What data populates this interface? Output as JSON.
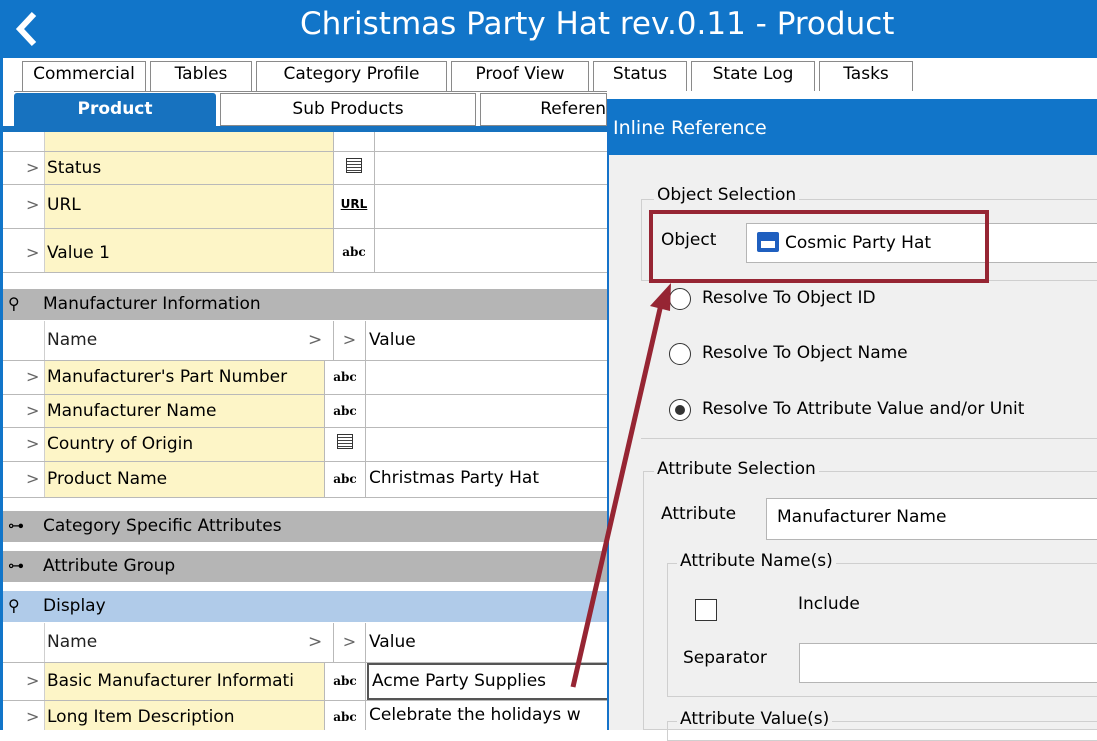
{
  "window": {
    "title": "Christmas Party Hat rev.0.11 - Product",
    "back_icon": "chevron-left-icon"
  },
  "tabs_row1": [
    {
      "label": "Commercial"
    },
    {
      "label": "Tables"
    },
    {
      "label": "Category Profile"
    },
    {
      "label": "Proof View"
    },
    {
      "label": "Status"
    },
    {
      "label": "State Log"
    },
    {
      "label": "Tasks"
    }
  ],
  "tabs_row2": [
    {
      "label": "Product",
      "active": true
    },
    {
      "label": "Sub Products"
    },
    {
      "label": "Referen"
    }
  ],
  "grid": {
    "top_rows": [
      {
        "name": "Status",
        "type_icon": "list-icon"
      },
      {
        "name": "URL",
        "type_icon": "url-icon",
        "type_text": "URL"
      },
      {
        "name": "Value 1",
        "type_icon": "text-icon",
        "type_text": "abc"
      }
    ],
    "manufacturer_group": "Manufacturer Information",
    "header": {
      "name": "Name",
      "value": "Value"
    },
    "manufacturer_rows": [
      {
        "name": "Manufacturer's Part Number",
        "type_text": "abc",
        "value": ""
      },
      {
        "name": "Manufacturer Name",
        "type_text": "abc",
        "value": ""
      },
      {
        "name": "Country of Origin",
        "type_icon": "list-icon",
        "value": ""
      },
      {
        "name": "Product Name",
        "type_text": "abc",
        "value": "Christmas Party Hat"
      }
    ],
    "category_group": "Category Specific Attributes",
    "attribute_group": "Attribute Group",
    "display_group": "Display",
    "display_rows": [
      {
        "name": "Basic Manufacturer Informati",
        "type_text": "abc",
        "value": "Acme Party Supplies"
      },
      {
        "name": "Long Item Description",
        "type_text": "abc",
        "value": "Celebrate the holidays w"
      }
    ],
    "expander": ">"
  },
  "dialog": {
    "title": "Inline Reference",
    "object_selection": {
      "legend": "Object Selection",
      "object_label": "Object",
      "object_value": "Cosmic Party Hat",
      "options": [
        {
          "label": "Resolve To Object ID",
          "checked": false
        },
        {
          "label": "Resolve To Object Name",
          "checked": false
        },
        {
          "label": "Resolve To Attribute Value and/or Unit",
          "checked": true
        }
      ]
    },
    "attribute_selection": {
      "legend": "Attribute Selection",
      "attribute_label": "Attribute",
      "attribute_value": "Manufacturer Name",
      "names_legend": "Attribute Name(s)",
      "include_label": "Include",
      "separator_label": "Separator",
      "separator_value": "",
      "values_legend": "Attribute Value(s)"
    }
  },
  "colors": {
    "title_blue": "#1175c9",
    "annotation_red": "#962533",
    "name_cell": "#fdf5c7",
    "group_gray": "#b5b5b5",
    "display_group": "#b0cbe9"
  }
}
